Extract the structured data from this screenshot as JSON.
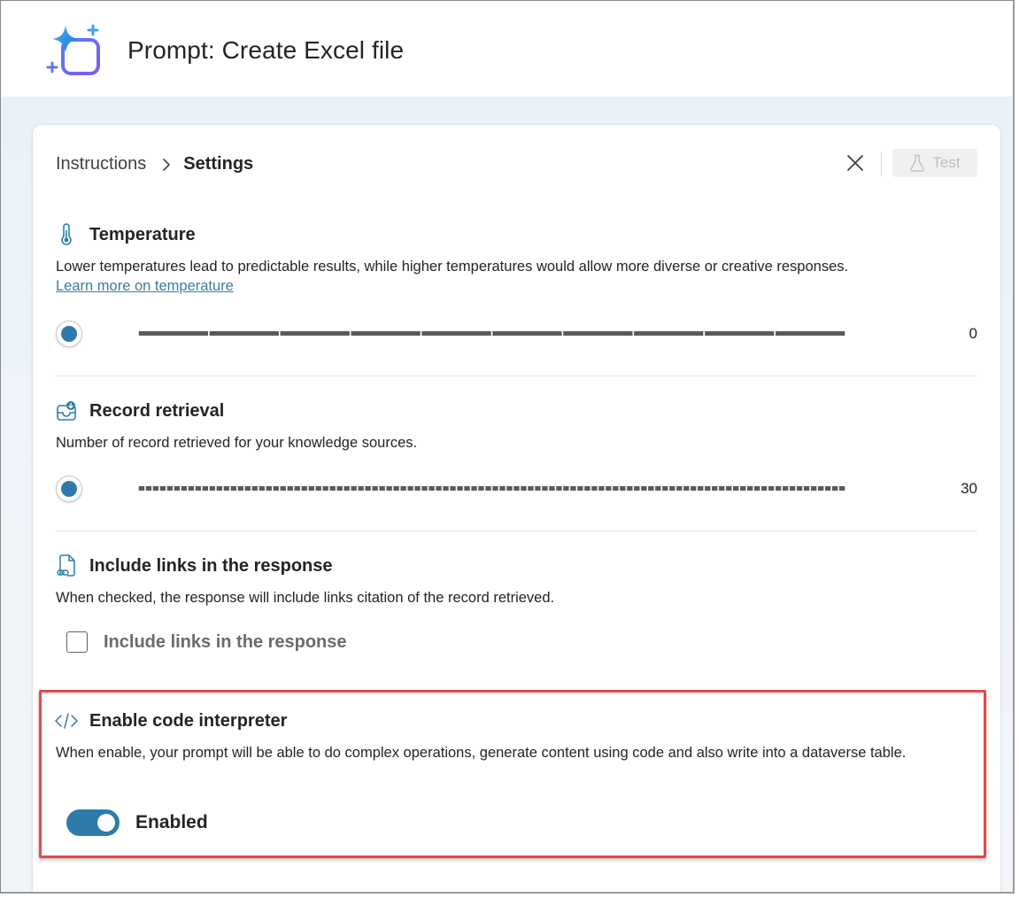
{
  "header": {
    "title": "Prompt: Create Excel file",
    "icon": "sparkle-document-icon"
  },
  "breadcrumb": {
    "parent": "Instructions",
    "current": "Settings"
  },
  "toolbar": {
    "test_label": "Test"
  },
  "temperature": {
    "title": "Temperature",
    "description": "Lower temperatures lead to predictable results, while higher temperatures would allow more diverse or creative responses.",
    "link": "Learn more on temperature",
    "value": "0",
    "fraction": 0,
    "steps": 10
  },
  "record_retrieval": {
    "title": "Record retrieval",
    "description": "Number of record retrieved for your knowledge sources.",
    "value": "30",
    "fraction": 0,
    "steps": 100
  },
  "include_links": {
    "title": "Include links in the response",
    "description": "When checked, the response will include links citation of the record retrieved.",
    "checkbox_label": "Include links in the response",
    "checked": false
  },
  "code_interpreter": {
    "title": "Enable code interpreter",
    "description": "When enable, your prompt will be able to do complex operations, generate content using code and also write into a dataverse table.",
    "toggle_label": "Enabled",
    "enabled": true
  },
  "colors": {
    "accent": "#2e7bab",
    "highlight": "#e5484d",
    "link": "#3a7ca5"
  }
}
